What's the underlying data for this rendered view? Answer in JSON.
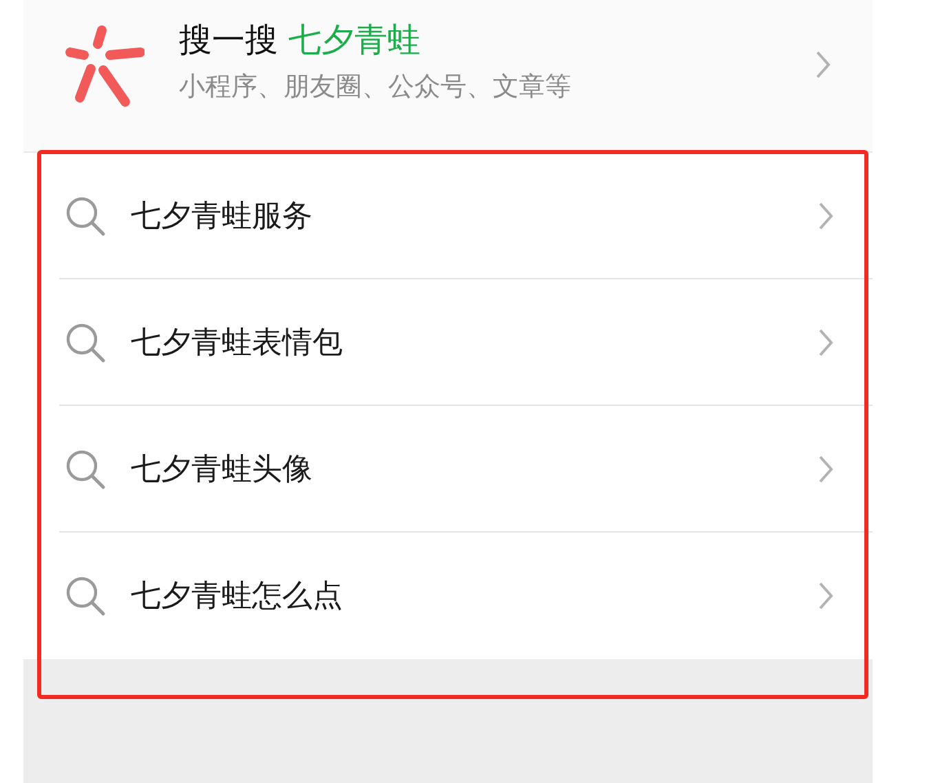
{
  "header": {
    "title": "搜一搜",
    "keyword": "七夕青蛙",
    "subtitle": "小程序、朋友圈、公众号、文章等"
  },
  "suggestions": [
    {
      "text": "七夕青蛙服务"
    },
    {
      "text": "七夕青蛙表情包"
    },
    {
      "text": "七夕青蛙头像"
    },
    {
      "text": "七夕青蛙怎么点"
    }
  ]
}
